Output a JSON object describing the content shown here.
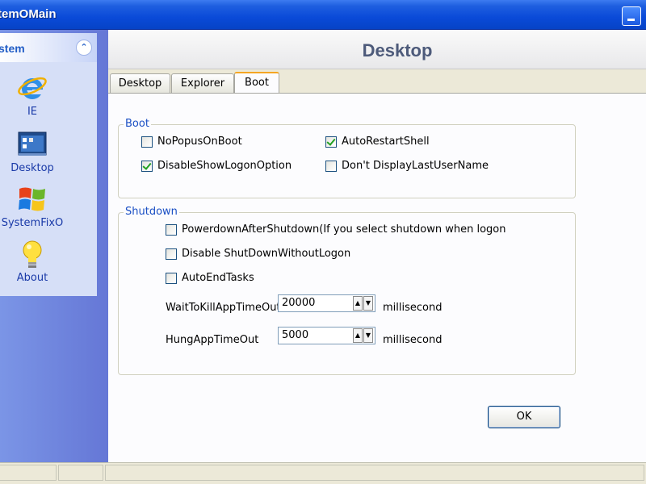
{
  "window": {
    "title": "temOMain"
  },
  "sidebar": {
    "header": "stem",
    "items": [
      {
        "label": "IE",
        "icon": "ie-icon"
      },
      {
        "label": "Desktop",
        "icon": "desktop-icon"
      },
      {
        "label": "SystemFixO",
        "icon": "windows-logo-icon"
      },
      {
        "label": "About",
        "icon": "lightbulb-icon"
      }
    ]
  },
  "main": {
    "heading": "Desktop",
    "tabs": [
      {
        "label": "Desktop",
        "active": false
      },
      {
        "label": "Explorer",
        "active": false
      },
      {
        "label": "Boot",
        "active": true
      }
    ],
    "boot_group": {
      "title": "Boot",
      "options": [
        {
          "label": "NoPopusOnBoot",
          "checked": false
        },
        {
          "label": "AutoRestartShell",
          "checked": true
        },
        {
          "label": "DisableShowLogonOption",
          "checked": true
        },
        {
          "label": "Don't DisplayLastUserName",
          "checked": false
        }
      ]
    },
    "shutdown_group": {
      "title": "Shutdown",
      "options": [
        {
          "label": "PowerdownAfterShutdown(If you select shutdown when logon",
          "checked": false
        },
        {
          "label": "Disable ShutDownWithoutLogon",
          "checked": false
        },
        {
          "label": "AutoEndTasks",
          "checked": false
        }
      ],
      "wait_to_kill": {
        "label": "WaitToKillAppTimeOut",
        "value": "20000",
        "unit": "millisecond"
      },
      "hung_app": {
        "label": "HungAppTimeOut",
        "value": "5000",
        "unit": "millisecond"
      }
    },
    "ok_label": "OK"
  },
  "colors": {
    "titlebar": "#0a4ad8",
    "sidebar_panel": "#d6dff7",
    "heading_text": "#4d5a7a",
    "group_caption": "#1a4fc4",
    "check_mark": "#21a121"
  }
}
